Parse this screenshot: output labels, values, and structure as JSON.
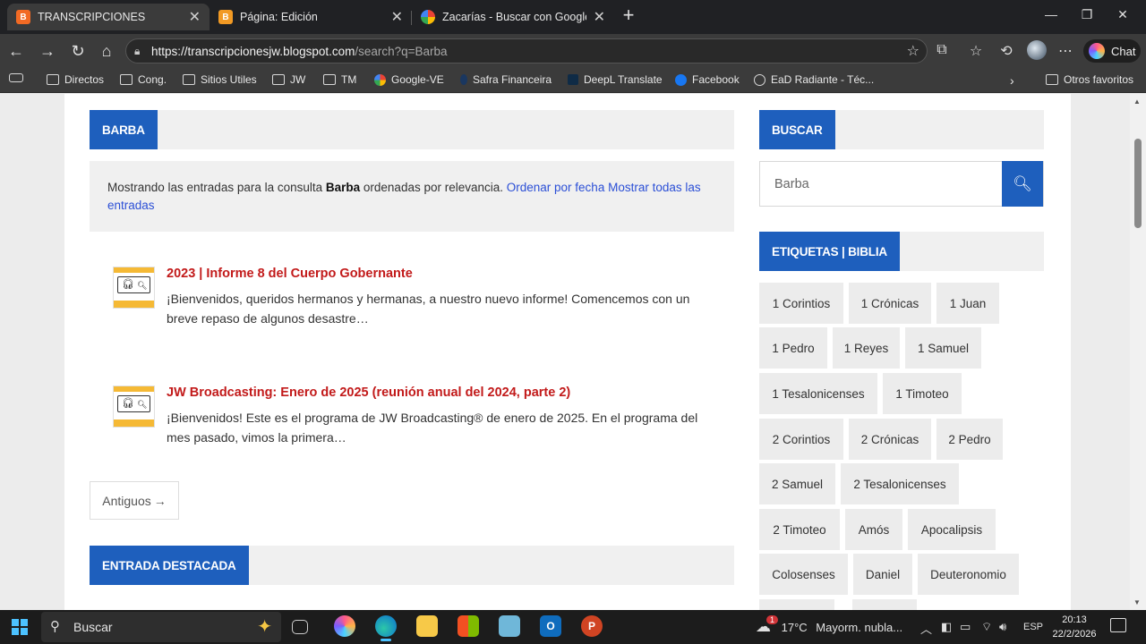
{
  "browser": {
    "tabs": [
      {
        "title": "TRANSCRIPCIONES",
        "favicon": "B",
        "favicon_color": "#f26a24",
        "active": true
      },
      {
        "title": "Página: Edición",
        "favicon": "B",
        "favicon_color": "#f29a24",
        "active": false
      },
      {
        "title": "Zacarías - Buscar con Google",
        "favicon": "G",
        "favicon_color": "#ffffff",
        "active": false
      }
    ],
    "url_host": "https://transcripcionesjw.blogspot.com",
    "url_path": "/search?q=Barba",
    "chat_label": "Chat",
    "bookmarks": [
      {
        "label": "Directos",
        "icon": "folder-icon"
      },
      {
        "label": "Cong.",
        "icon": "folder-icon"
      },
      {
        "label": "Sitios Utiles",
        "icon": "folder-icon"
      },
      {
        "label": "JW",
        "icon": "folder-icon"
      },
      {
        "label": "TM",
        "icon": "folder-icon"
      },
      {
        "label": "Google-VE",
        "icon": "google-icon"
      },
      {
        "label": "Safra Financeira",
        "icon": "safra-icon"
      },
      {
        "label": "DeepL Translate",
        "icon": "deepl-icon"
      },
      {
        "label": "Facebook",
        "icon": "facebook-icon"
      },
      {
        "label": "EaD Radiante - Téc...",
        "icon": "globe-icon"
      }
    ],
    "other_bookmarks": "Otros favoritos"
  },
  "page": {
    "search_header": "BARBA",
    "info": {
      "prefix": "Mostrando las entradas para la consulta ",
      "query": "Barba",
      "suffix": " ordenadas por relevancia. ",
      "link1": "Ordenar por fecha",
      "link2": "Mostrar todas las entradas"
    },
    "posts": [
      {
        "title": "2023 | Informe 8 del Cuerpo Gobernante",
        "excerpt": "¡Bienvenidos, queridos hermanos y hermanas, a nuestro nuevo informe! Comencemos con un breve repaso de algunos desastre…"
      },
      {
        "title": "JW Broadcasting: Enero de 2025 (reunión anual del 2024, parte 2)",
        "excerpt": "¡Bienvenidos! Este es el programa de JW Broadcasting® de enero de 2025. En el programa del mes pasado, vimos la primera…"
      }
    ],
    "older_label": "Antiguos",
    "featured_header": "ENTRADA DESTACADA",
    "sidebar": {
      "search_header": "BUSCAR",
      "search_value": "Barba",
      "tags_header": "ETIQUETAS | BIBLIA",
      "tags": [
        "1 Corintios",
        "1 Crónicas",
        "1 Juan",
        "1 Pedro",
        "1 Reyes",
        "1 Samuel",
        "1 Tesalonicenses",
        "1 Timoteo",
        "2 Corintios",
        "2 Crónicas",
        "2 Pedro",
        "2 Samuel",
        "2 Tesalonicenses",
        "2 Timoteo",
        "Amós",
        "Apocalipsis",
        "Colosenses",
        "Daniel",
        "Deuteronomio"
      ]
    },
    "accent_color": "#1e5fbd",
    "post_title_color": "#c21a1a"
  },
  "taskbar": {
    "search_placeholder": "Buscar",
    "weather_temp": "17°C",
    "weather_text": "Mayorm. nubla...",
    "weather_badge": "1",
    "lang": "ESP",
    "time": "20:13",
    "date": "22/2/2026"
  }
}
